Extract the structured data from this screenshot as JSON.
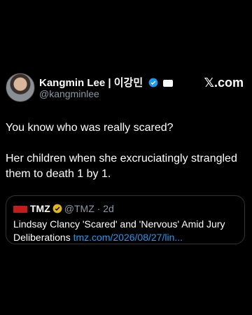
{
  "author": {
    "name": "Kangmin Lee | 이강민",
    "handle": "@kangminlee"
  },
  "brand": "𝕏.com",
  "tweet": {
    "text": "You know who was really scared?\n\nHer children when she excruciatingly strangled them to death 1 by 1."
  },
  "quoted": {
    "name": "TMZ",
    "handle": "@TMZ",
    "sep": "·",
    "time": "2d",
    "text": "Lindsay Clancy 'Scared' and 'Nervous' Amid Jury Deliberations",
    "link": "tmz.com/2026/08/27/lin..."
  },
  "colors": {
    "verified_blue": "#1d9bf0",
    "verified_gold": "#e2b719",
    "link": "#1d9bf0"
  },
  "icons": [
    "verified-badge-icon",
    "affiliate-badge-icon",
    "tmz-logo-icon",
    "gold-verified-icon"
  ]
}
